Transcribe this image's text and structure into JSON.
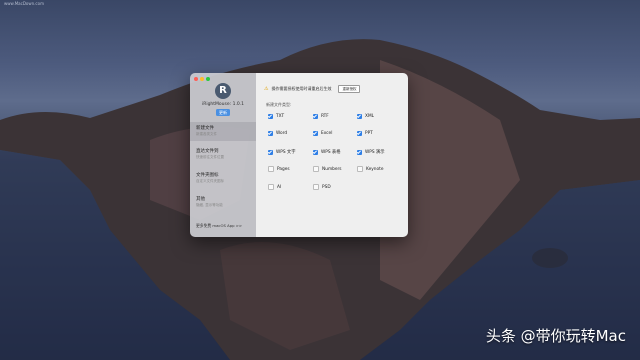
{
  "browser": {
    "url": "www.MacDown.com"
  },
  "watermark": "头条 @带你玩转Mac",
  "app": {
    "name": "iRightMouse: 1.0.1",
    "logo_letter": "R",
    "update_button": "更新"
  },
  "sidebar": {
    "items": [
      {
        "title": "新建文件",
        "subtitle": "新建各类文件"
      },
      {
        "title": "直达文件到",
        "subtitle": "快速前往文件位置"
      },
      {
        "title": "文件夹图标",
        "subtitle": "自定义文件夹图标"
      },
      {
        "title": "其他",
        "subtitle": "隐藏, 显示等功能"
      }
    ],
    "more_apps": "更多免费 macOS App >>"
  },
  "content": {
    "tip": "操作需要授权使用时请重启后生效",
    "tip_button": "重新授权",
    "section_label": "新建文件类型:",
    "options": [
      {
        "label": "TXT",
        "checked": true
      },
      {
        "label": "RTF",
        "checked": true
      },
      {
        "label": "XML",
        "checked": true
      },
      {
        "label": "Word",
        "checked": true
      },
      {
        "label": "Excel",
        "checked": true
      },
      {
        "label": "PPT",
        "checked": true
      },
      {
        "label": "WPS 文字",
        "checked": true
      },
      {
        "label": "WPS 表格",
        "checked": true
      },
      {
        "label": "WPS 演示",
        "checked": true
      },
      {
        "label": "Pages",
        "checked": false
      },
      {
        "label": "Numbers",
        "checked": false
      },
      {
        "label": "Keynote",
        "checked": false
      },
      {
        "label": "AI",
        "checked": false
      },
      {
        "label": "PSD",
        "checked": false
      }
    ]
  }
}
